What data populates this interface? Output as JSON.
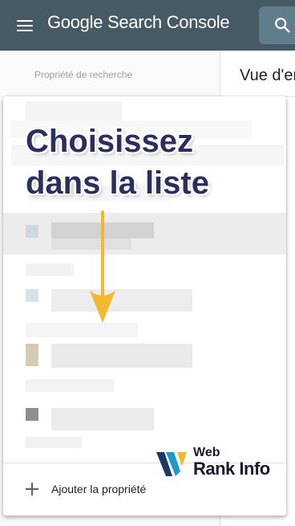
{
  "app": {
    "title": "Google Search Console"
  },
  "header": {
    "menu_icon": "menu-icon",
    "search_icon": "search-icon"
  },
  "left_panel": {
    "property_label": "Propriété de recherche"
  },
  "main": {
    "title": "Vue d'en"
  },
  "dropdown": {
    "add_property_label": "Ajouter la propriété",
    "add_icon": "plus-icon"
  },
  "overlay": {
    "caption_line1": "Choisissez",
    "caption_line2": "dans la liste",
    "arrow_color": "#f5b731"
  },
  "watermark": {
    "line1": "Web",
    "line2": "Rank Info"
  },
  "colors": {
    "appbar": "#455a64",
    "caption_text": "#2c2f5b",
    "arrow": "#f5b731"
  }
}
